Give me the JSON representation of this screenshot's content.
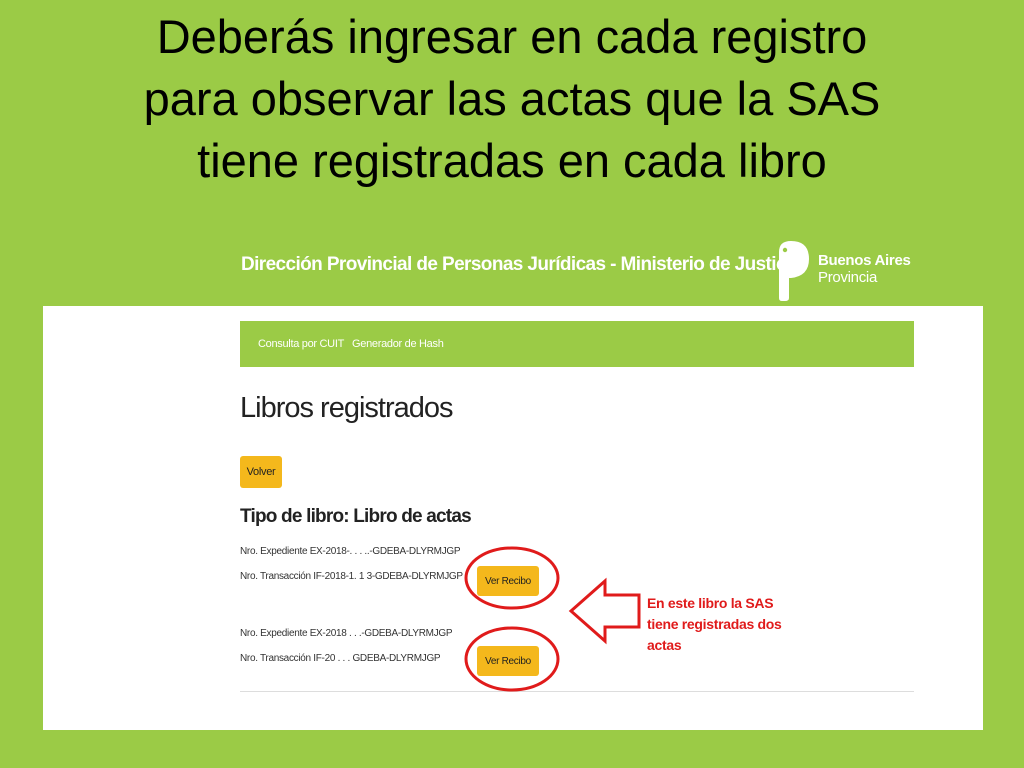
{
  "slide": {
    "title_lines": [
      "Deberás ingresar en cada registro",
      "para observar las actas que la SAS",
      "tiene registradas en cada libro"
    ]
  },
  "header": {
    "title": "Dirección Provincial de Personas Jurídicas - Ministerio de Justicia",
    "logo": {
      "line1": "Buenos Aires",
      "line2": "Provincia",
      "mark": "buenos-aires-p-logo"
    }
  },
  "nav": {
    "items": [
      "Consulta por CUIT",
      "Generador de Hash"
    ]
  },
  "page": {
    "heading": "Libros registrados",
    "back_button": "Volver",
    "section_heading": "Tipo de libro: Libro de actas",
    "records": [
      {
        "expediente": "Nro. Expediente EX-2018-. .  .   ..-GDEBA-DLYRMJGP",
        "transaccion": "Nro. Transacción IF-2018-1.  1   3-GDEBA-DLYRMJGP",
        "button": "Ver Recibo"
      },
      {
        "expediente": "Nro. Expediente EX-2018  .  .  .-GDEBA-DLYRMJGP",
        "transaccion": "Nro. Transacción IF-20 .    . .  GDEBA-DLYRMJGP",
        "button": "Ver Recibo"
      }
    ]
  },
  "annotation": {
    "lines": [
      "En este libro la SAS",
      "tiene registradas dos",
      "actas"
    ],
    "color": "#e01b1b"
  },
  "colors": {
    "brand_green": "#9bcb46",
    "button_yellow": "#f4b81c",
    "highlight_red": "#e01b1b"
  }
}
